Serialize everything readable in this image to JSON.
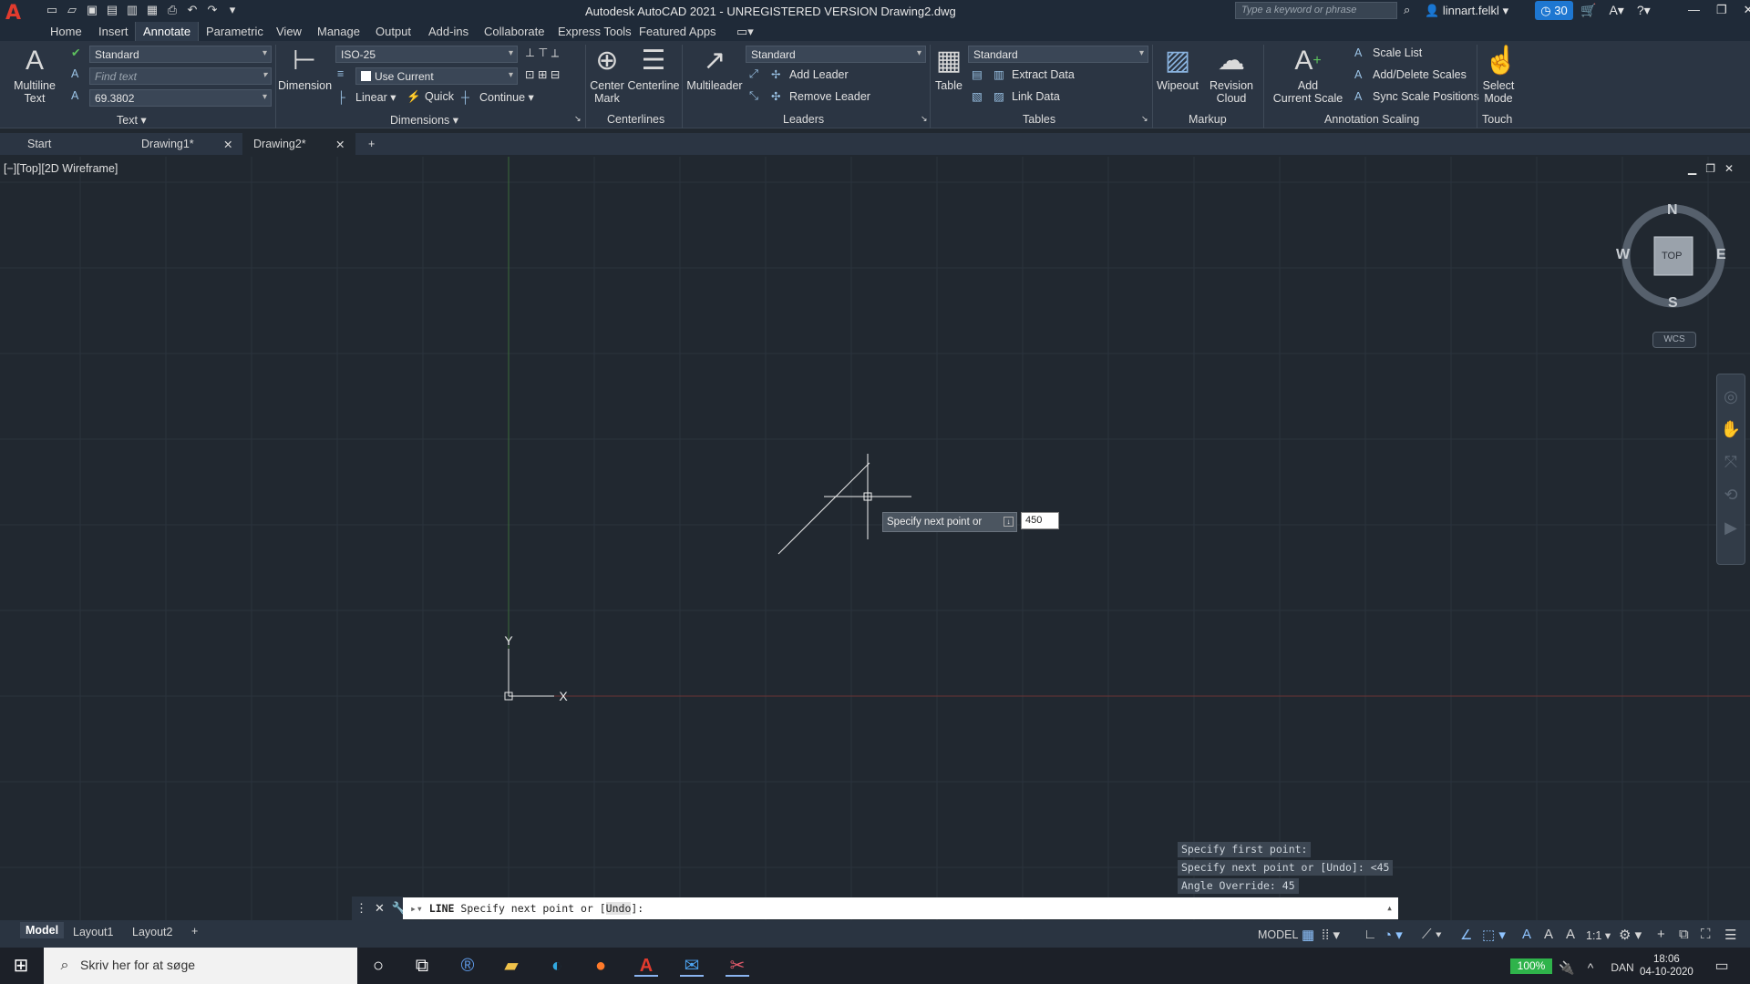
{
  "window": {
    "title": "Autodesk AutoCAD 2021 - UNREGISTERED VERSION    Drawing2.dwg",
    "search_placeholder": "Type a keyword or phrase",
    "user": "linnart.felkl",
    "badge_count": "30"
  },
  "menu": [
    "Home",
    "Insert",
    "Annotate",
    "Parametric",
    "View",
    "Manage",
    "Output",
    "Add-ins",
    "Collaborate",
    "Express Tools",
    "Featured Apps"
  ],
  "menu_active": "Annotate",
  "ribbon": {
    "text_panel": {
      "big_label": "Multiline\nText",
      "style": "Standard",
      "find_placeholder": "Find text",
      "height": "69.3802",
      "panel": "Text"
    },
    "dimensions_panel": {
      "big_label": "Dimension",
      "style": "ISO-25",
      "layer": "Use Current",
      "linear": "Linear",
      "quick": "Quick",
      "continue": "Continue",
      "panel": "Dimensions"
    },
    "centerlines_panel": {
      "center_mark": "Center\nMark",
      "centerline": "Centerline",
      "panel": "Centerlines"
    },
    "leaders_panel": {
      "big_label": "Multileader",
      "style": "Standard",
      "add": "Add Leader",
      "remove": "Remove Leader",
      "panel": "Leaders"
    },
    "tables_panel": {
      "big_label": "Table",
      "style": "Standard",
      "extract": "Extract Data",
      "link": "Link Data",
      "panel": "Tables"
    },
    "markup_panel": {
      "wipeout": "Wipeout",
      "revision": "Revision\nCloud",
      "panel": "Markup"
    },
    "scaling_panel": {
      "add_scale": "Add\nCurrent Scale",
      "scale_list": "Scale List",
      "add_delete": "Add/Delete Scales",
      "sync": "Sync Scale Positions",
      "panel": "Annotation Scaling"
    },
    "touch_panel": {
      "select_mode": "Select\nMode",
      "panel": "Touch"
    }
  },
  "doc_tabs": [
    "Start",
    "Drawing1*",
    "Drawing2*"
  ],
  "viewport": {
    "label": "[−][Top][2D Wireframe]",
    "compass": {
      "n": "N",
      "s": "S",
      "e": "E",
      "w": "W",
      "center": "TOP"
    },
    "wcs": "WCS",
    "ucs_x": "X",
    "ucs_y": "Y",
    "tooltip": "Specify next point or",
    "tooltip_value": "450"
  },
  "command_history": [
    "Specify first point:",
    "Specify next point or [Undo]: <45",
    "Angle Override: 45"
  ],
  "command_line": {
    "keyword": "LINE",
    "prompt": "Specify next point or [",
    "option": "Undo",
    "suffix": "]:"
  },
  "layout_tabs": [
    "Model",
    "Layout1",
    "Layout2"
  ],
  "status": {
    "model": "MODEL",
    "scale": "1:1"
  },
  "taskbar": {
    "search": "Skriv her for at søge",
    "battery": "100%",
    "lang": "DAN",
    "time": "18:06",
    "date": "04-10-2020"
  }
}
